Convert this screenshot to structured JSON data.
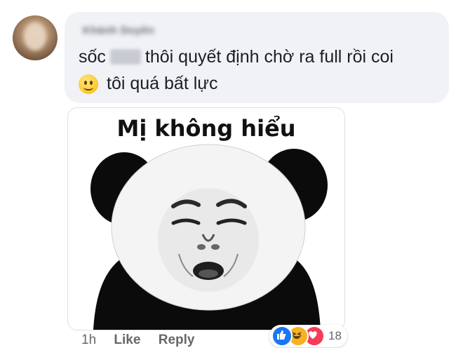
{
  "comment": {
    "author": "Khánh Duyên",
    "text_part1": "sốc",
    "text_part2": "thôi quyết định chờ ra full rồi coi",
    "text_line2": "tôi quá bất lực",
    "emoji": "smiley-face-icon"
  },
  "sticker": {
    "caption": "Mị không hiểu",
    "icon": "panda-meme-sticker"
  },
  "actions": {
    "time": "1h",
    "like_label": "Like",
    "reply_label": "Reply"
  },
  "reactions": {
    "types": [
      "like",
      "haha",
      "love"
    ],
    "count": "18",
    "colors": {
      "like": "#1877f2",
      "haha": "#f7b125",
      "love": "#f33e58"
    }
  },
  "colors": {
    "bubble_bg": "#f0f2f5",
    "text": "#1c1e21",
    "meta_text": "#65676b"
  }
}
